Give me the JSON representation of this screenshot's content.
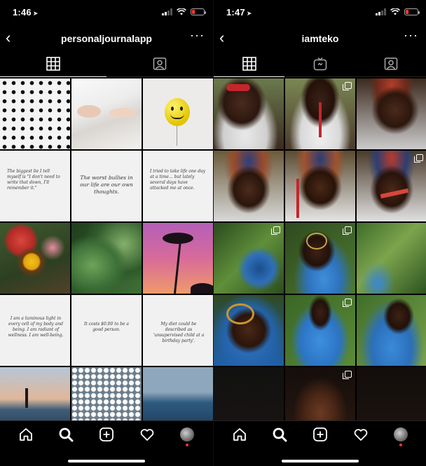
{
  "left": {
    "status": {
      "time": "1:46"
    },
    "header": {
      "username": "personaljournalapp",
      "more": "···"
    },
    "quotes": [
      "The biggest lie I tell myself is \"I don't need to write that down, I'll remember it.\"",
      "The worst bullies in our life are our own thoughts.",
      "I tried to take life one day at a time... but lately several days have attacked me at once.",
      "I am a luminous light in every cell of my body and being. I am radiant of wellness. I am well-being.",
      "It costs $0.00 to be a good person.",
      "My diet could be described as 'unsupervised child at a birthday party'."
    ]
  },
  "right": {
    "status": {
      "time": "1:47"
    },
    "header": {
      "username": "iamteko",
      "more": "···"
    }
  },
  "colors": {
    "notification": "#ff3040",
    "battery_low": "#ff3b30"
  }
}
